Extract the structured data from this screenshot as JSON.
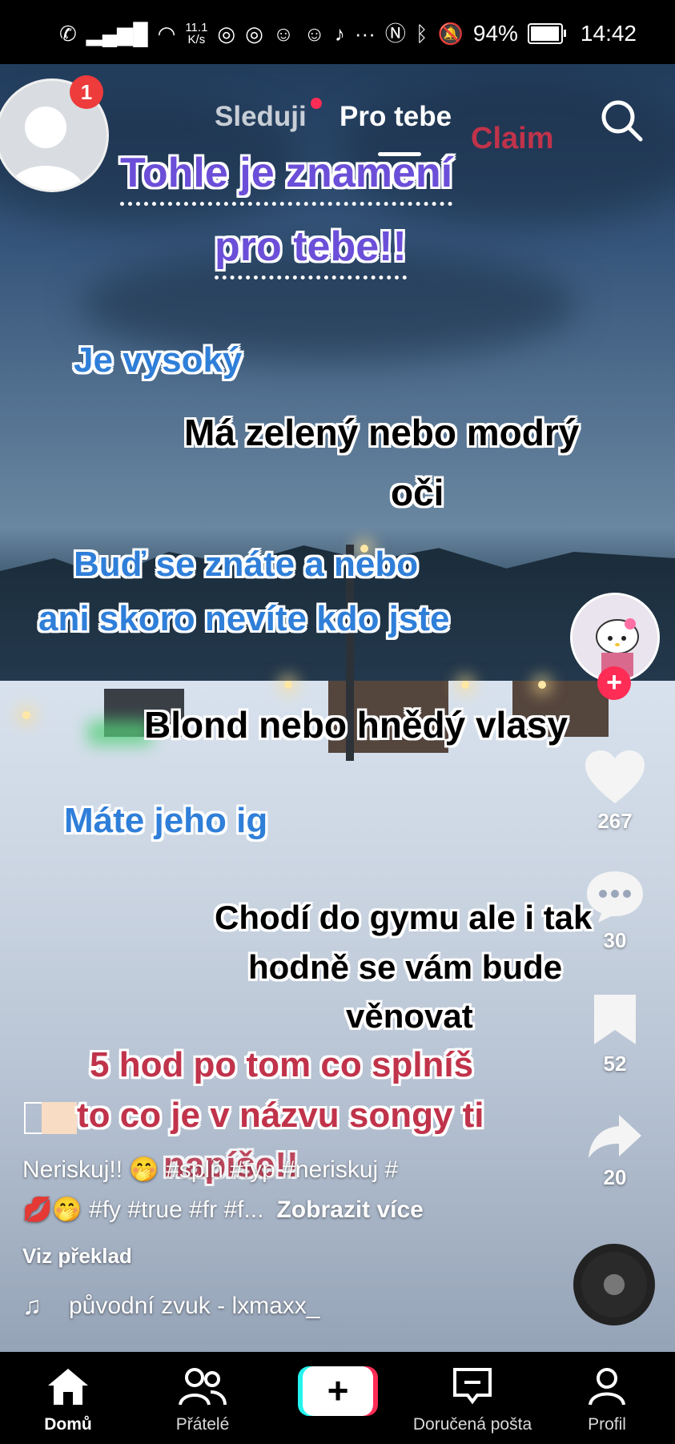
{
  "status_bar": {
    "net_speed_value": "11.1",
    "net_speed_unit": "K/s",
    "battery": "94%",
    "time": "14:42"
  },
  "notifications": {
    "badge": "1"
  },
  "feed_tabs": {
    "following": "Sleduji",
    "for_you": "Pro tebe"
  },
  "overlay": {
    "title_line1": "Tohle je znamení",
    "title_line2": "pro tebe!!",
    "claim": "Claim",
    "line1": "Je vysoký",
    "line2a": "Má zelený nebo modrý",
    "line2b": "oči",
    "line3a": "Buď se znáte a nebo",
    "line3b": "ani skoro nevíte kdo jste",
    "line4": "Blond nebo hnědý vlasy",
    "line5": "Máte jeho ig",
    "line6a": "Chodí do gymu ale i tak",
    "line6b": "hodně se vám bude",
    "line6c": "věnovat",
    "line7a": "5 hod po tom co splníš",
    "line7b": "to co je v názvu songy ti",
    "line7c": "napíše!!"
  },
  "actions": {
    "likes": "267",
    "comments": "30",
    "saves": "52",
    "shares": "20"
  },
  "caption": {
    "line1": "Neriskuj!! 🤭 #splň #fyp #neriskuj #",
    "line2": "💋🤭 #fy #true #fr #f...",
    "more": "Zobrazit více",
    "translate": "Viz překlad"
  },
  "sound": {
    "label": "původní zvuk - lxmaxx_"
  },
  "bottom_nav": {
    "home": "Domů",
    "friends": "Přátelé",
    "create": "+",
    "inbox": "Doručená pošta",
    "profile": "Profil"
  },
  "colors": {
    "accent_red": "#fe2c55",
    "accent_cyan": "#25f4ee",
    "purple_text": "#6b4fd8",
    "blue_text": "#2f7fd9",
    "red_text": "#c0334a"
  }
}
